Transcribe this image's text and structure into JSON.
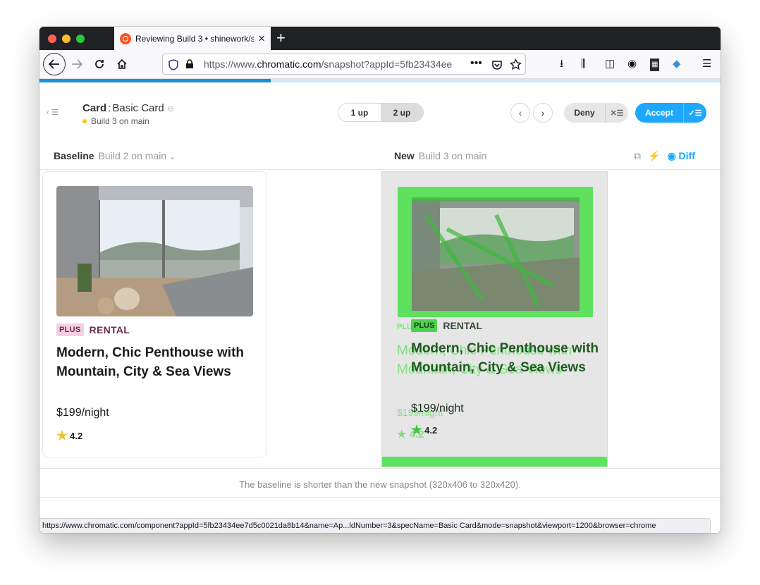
{
  "browser": {
    "tab_title": "Reviewing Build 3 • shinework/s",
    "url_prefix": "https://www.",
    "url_domain": "chromatic.com",
    "url_rest": "/snapshot?appId=5fb23434ee",
    "status_url": "https://www.chromatic.com/component?appId=5fb23434ee7d5c0021da8b14&name=Ap...ldNumber=3&specName=Basic Card&mode=snapshot&viewport=1200&browser=chrome",
    "load_progress": 0.34
  },
  "header": {
    "component": "Card",
    "story": "Basic Card",
    "build": "Build 3 on main",
    "view_modes": [
      "1 up",
      "2 up"
    ],
    "active_view": "2 up",
    "deny_label": "Deny",
    "accept_label": "Accept",
    "accent_color": "#1ea7fd",
    "build_status_color": "#ffc700"
  },
  "columns": {
    "baseline_label": "Baseline",
    "baseline_build": "Build 2 on main",
    "new_label": "New",
    "new_build": "Build 3 on main",
    "diff_label": "Diff"
  },
  "card": {
    "badge": "PLUS",
    "category": "RENTAL",
    "title": "Modern, Chic Penthouse with Mountain, City & Sea Views",
    "price": "$199/night",
    "rating": "4.2"
  },
  "footer_message": "The baseline is shorter than the new snapshot (320x406 to 320x420).",
  "colors": {
    "badge_bg": "#f5d0e5",
    "badge_text": "#6b2c4b",
    "diff_green": "#5ee35e"
  }
}
